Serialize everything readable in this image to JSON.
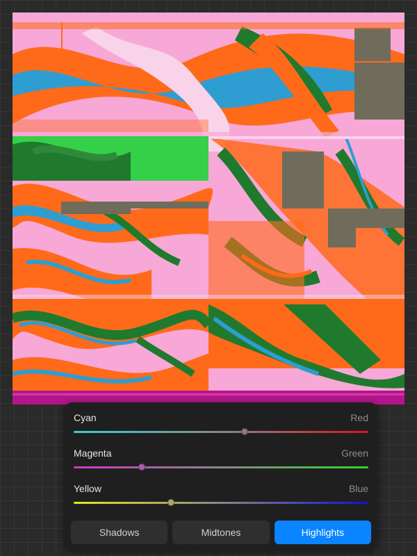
{
  "canvas": {
    "description_icon": "glitch-artwork",
    "colors": [
      "#f7a8d6",
      "#ff6a1a",
      "#1f7a2e",
      "#2e9dd1",
      "#34d048",
      "#6f6c5c",
      "#b3168c"
    ]
  },
  "color_balance": {
    "sliders": [
      {
        "left_label": "Cyan",
        "right_label": "Red",
        "value": 0.58,
        "gradient_start": "#32d2d8",
        "gradient_end": "#e0101a"
      },
      {
        "left_label": "Magenta",
        "right_label": "Green",
        "value": 0.23,
        "gradient_start": "#c93ac9",
        "gradient_end": "#2fd52f"
      },
      {
        "left_label": "Yellow",
        "right_label": "Blue",
        "value": 0.33,
        "gradient_start": "#e8e81a",
        "gradient_end": "#1010d8"
      }
    ],
    "tabs": [
      {
        "label": "Shadows",
        "active": false
      },
      {
        "label": "Midtones",
        "active": false
      },
      {
        "label": "Highlights",
        "active": true
      }
    ],
    "accent_color": "#0a84ff"
  }
}
